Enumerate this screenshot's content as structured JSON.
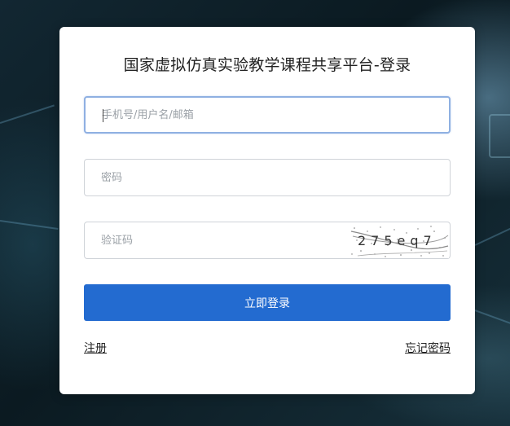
{
  "page": {
    "title": "国家虚拟仿真实验教学课程共享平台-登录"
  },
  "form": {
    "username_placeholder": "手机号/用户名/邮箱",
    "username_value": "",
    "password_placeholder": "密码",
    "password_value": "",
    "captcha_placeholder": "验证码",
    "captcha_value": "",
    "captcha_image_text": "275eq7",
    "login_label": "立即登录"
  },
  "links": {
    "register": "注册",
    "forgot_password": "忘记密码"
  },
  "colors": {
    "primary": "#236bd0",
    "focus_border": "#8fb0e2",
    "background": "#0e1d24"
  }
}
